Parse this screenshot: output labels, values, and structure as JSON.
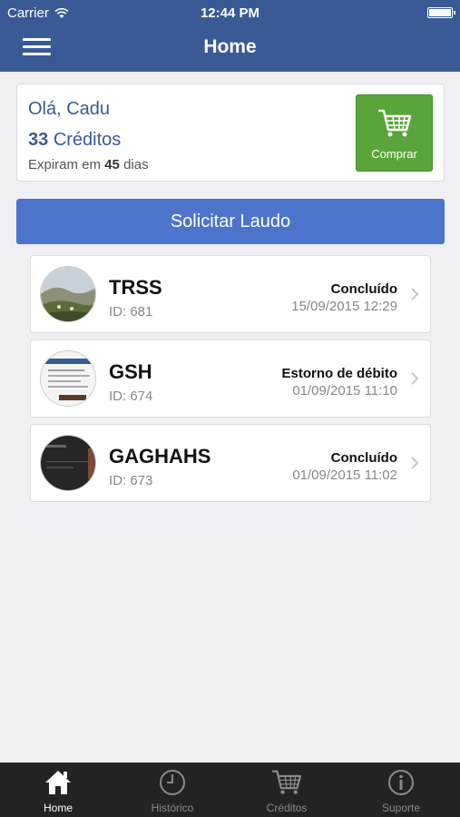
{
  "status_bar": {
    "carrier": "Carrier",
    "time": "12:44 PM"
  },
  "nav": {
    "title": "Home"
  },
  "account": {
    "greeting": "Olá, Cadu",
    "credits_count": "33",
    "credits_label": "Créditos",
    "expires_prefix": "Expiram em",
    "expires_days": "45",
    "expires_suffix": "dias",
    "buy_label": "Comprar"
  },
  "request_button": "Solicitar Laudo",
  "reports": [
    {
      "name": "TRSS",
      "id": "ID: 681",
      "status": "Concluído",
      "date": "15/09/2015 12:29",
      "thumb": "landscape-photo"
    },
    {
      "name": "GSH",
      "id": "ID: 674",
      "status": "Estorno de débito",
      "date": "01/09/2015 11:10",
      "thumb": "document-screenshot"
    },
    {
      "name": "GAGHAHS",
      "id": "ID: 673",
      "status": "Concluído",
      "date": "01/09/2015 11:02",
      "thumb": "dark-screenshot"
    }
  ],
  "tabs": [
    {
      "label": "Home",
      "icon": "home-icon",
      "active": true
    },
    {
      "label": "Histórico",
      "icon": "clock-icon",
      "active": false
    },
    {
      "label": "Créditos",
      "icon": "cart-icon",
      "active": false
    },
    {
      "label": "Suporte",
      "icon": "info-icon",
      "active": false
    }
  ],
  "colors": {
    "nav_bar": "#3a5a96",
    "buy_button": "#5aa53a",
    "request_button": "#4d74cc",
    "tab_bar": "#222326"
  }
}
